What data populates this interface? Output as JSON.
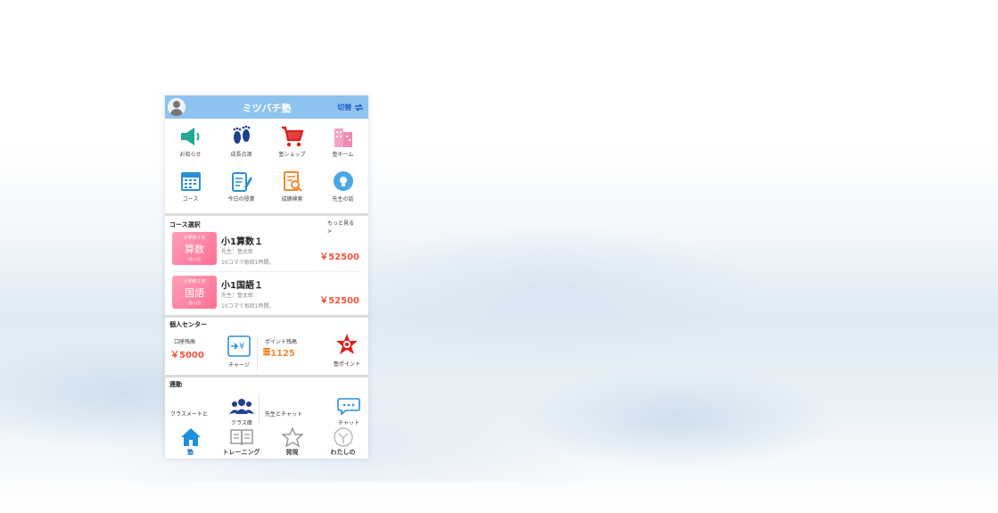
{
  "header": {
    "title": "ミツバチ塾",
    "switch_label": "切替"
  },
  "grid": [
    {
      "label": "お知らせ",
      "icon": "speaker-icon"
    },
    {
      "label": "成長点滴",
      "icon": "footprints-icon"
    },
    {
      "label": "塾ショップ",
      "icon": "cart-icon"
    },
    {
      "label": "塾ホーム",
      "icon": "building-icon"
    },
    {
      "label": "コース",
      "icon": "calendar-icon"
    },
    {
      "label": "今日の授業",
      "icon": "notebook-pen-icon"
    },
    {
      "label": "成績検索",
      "icon": "document-search-icon"
    },
    {
      "label": "先生の話",
      "icon": "lightbulb-icon"
    }
  ],
  "courses": {
    "section_title": "コース選択",
    "more_label": "もっと見る >",
    "items": [
      {
        "thumb_top": "小学校１年",
        "thumb_subject": "算数",
        "thumb_bottom": "（第１回）",
        "name": "小1算数１",
        "teacher": "先生：塾太郎",
        "desc": "10コマで毎回1時間。",
        "price": "￥52500"
      },
      {
        "thumb_top": "小学校１年",
        "thumb_subject": "国語",
        "thumb_bottom": "（第１回）",
        "name": "小1国語１",
        "teacher": "先生：塾太郎",
        "desc": "10コマで毎回1時間。",
        "price": "￥52500"
      }
    ]
  },
  "personal": {
    "section_title": "個人センター",
    "balance_label": "口座残高",
    "balance_value": "￥5000",
    "charge_label": "チャージ",
    "points_label": "ポイント残高",
    "points_value": "1125",
    "juku_points_label": "塾ポイント"
  },
  "contact": {
    "section_title": "連動",
    "classmates_label": "クラスメートと",
    "class_group_label": "クラス面",
    "teacher_chat_label": "先生とチャット",
    "chat_label": "チャット"
  },
  "tabs": [
    {
      "label": "塾",
      "active": true
    },
    {
      "label": "トレーニング",
      "active": false
    },
    {
      "label": "発現",
      "active": false
    },
    {
      "label": "わたしの",
      "active": false
    }
  ]
}
